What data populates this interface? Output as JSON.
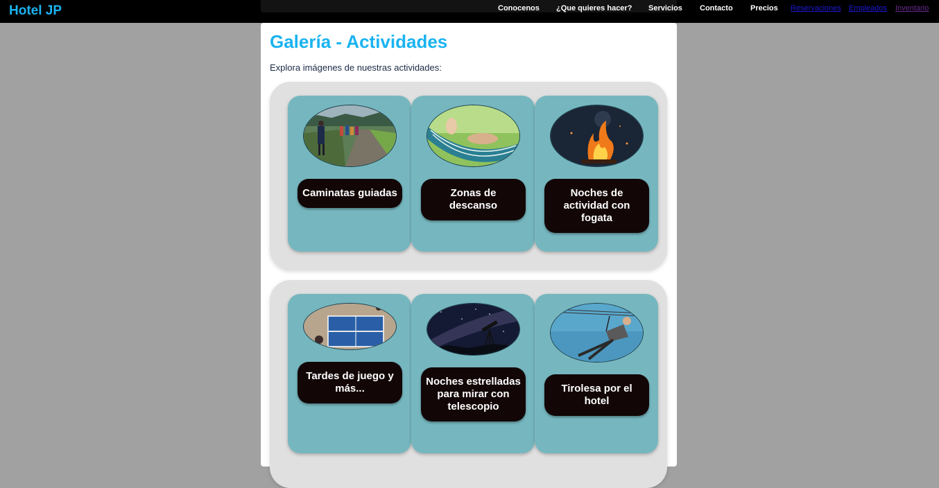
{
  "brand": {
    "name": "Hotel JP",
    "color": "#1ab3f0"
  },
  "nav": {
    "items": [
      "Conocenos",
      "¿Que quieres hacer?",
      "Servicios",
      "Contacto",
      "Precios"
    ],
    "links": [
      "Reservaciones",
      "Empleados",
      "Inventario"
    ],
    "link_colors": [
      "#1d18d6",
      "#1d18d6",
      "#6a2a8e"
    ]
  },
  "page": {
    "title": "Galería - Actividades",
    "intro": "Explora imágenes de nuestras actividades:"
  },
  "activities": [
    {
      "label": "Caminatas guiadas",
      "image": "hikers-on-trail-photo"
    },
    {
      "label": "Zonas de descanso",
      "image": "hammock-photo"
    },
    {
      "label": "Noches de actividad con fogata",
      "image": "campfire-photo"
    },
    {
      "label": "Tardes de juego y más...",
      "image": "ping-pong-table-photo"
    },
    {
      "label": "Noches estrelladas para mirar con telescopio",
      "image": "telescope-milky-way-photo"
    },
    {
      "label": "Tirolesa por el hotel",
      "image": "zipline-photo"
    }
  ],
  "colors": {
    "page_bg": "#a0a1a0",
    "card_bg": "#76b7bf",
    "label_bg": "#120607",
    "row_bg": "#e0e0e0"
  }
}
